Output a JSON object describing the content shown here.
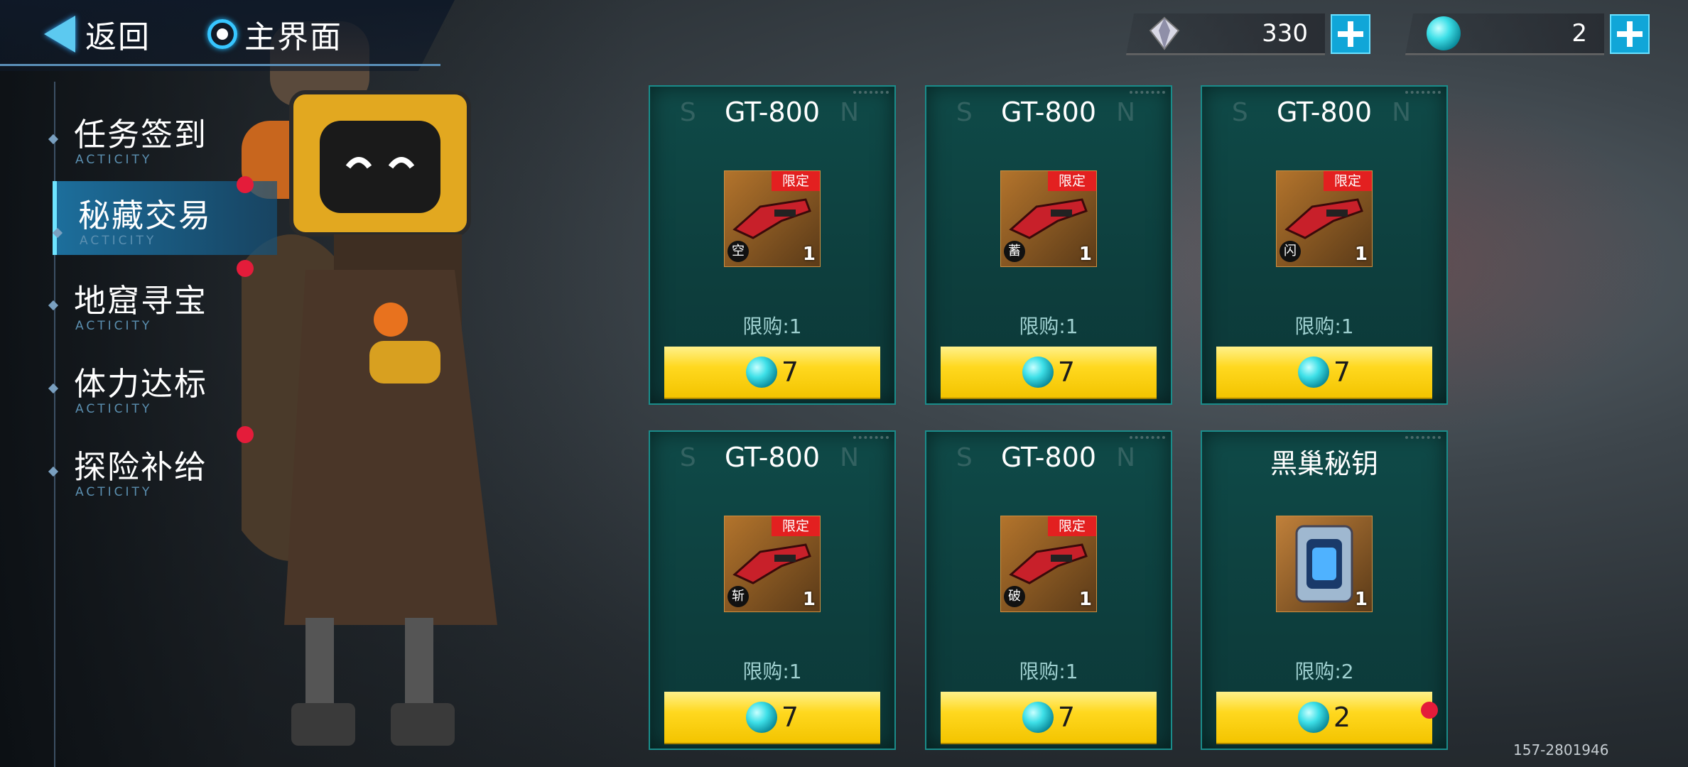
{
  "nav": {
    "back_label": "返回",
    "home_label": "主界面"
  },
  "currency": [
    {
      "icon": "crystal-icon",
      "value": "330"
    },
    {
      "icon": "orb-icon",
      "value": "2"
    }
  ],
  "sidebar": {
    "items": [
      {
        "label": "任务签到",
        "sub": "ACTICITY",
        "active": false,
        "dot": false
      },
      {
        "label": "秘藏交易",
        "sub": "ACTICITY",
        "active": true,
        "dot": true
      },
      {
        "label": "地窟寻宝",
        "sub": "ACTICITY",
        "active": false,
        "dot": true
      },
      {
        "label": "体力达标",
        "sub": "ACTICITY",
        "active": false,
        "dot": false
      },
      {
        "label": "探险补给",
        "sub": "ACTICITY",
        "active": false,
        "dot": true
      }
    ]
  },
  "cards": [
    {
      "title": "GT-800",
      "title_bg_left": "S",
      "title_bg_right": "N",
      "badge": "限定",
      "tag": "空",
      "qty": "1",
      "limit": "限购:1",
      "price": "7"
    },
    {
      "title": "GT-800",
      "title_bg_left": "S",
      "title_bg_right": "N",
      "badge": "限定",
      "tag": "蓄",
      "qty": "1",
      "limit": "限购:1",
      "price": "7"
    },
    {
      "title": "GT-800",
      "title_bg_left": "S",
      "title_bg_right": "N",
      "badge": "限定",
      "tag": "闪",
      "qty": "1",
      "limit": "限购:1",
      "price": "7"
    },
    {
      "title": "GT-800",
      "title_bg_left": "S",
      "title_bg_right": "N",
      "badge": "限定",
      "tag": "斩",
      "qty": "1",
      "limit": "限购:1",
      "price": "7"
    },
    {
      "title": "GT-800",
      "title_bg_left": "S",
      "title_bg_right": "N",
      "badge": "限定",
      "tag": "破",
      "qty": "1",
      "limit": "限购:1",
      "price": "7"
    },
    {
      "title": "黑巢秘钥",
      "title_bg_left": "",
      "title_bg_right": "",
      "badge": "",
      "tag": "",
      "qty": "1",
      "limit": "限购:2",
      "price": "2"
    }
  ],
  "footer_id": "157-2801946",
  "colors": {
    "accent": "#37c6ff",
    "alert": "#e41c3a",
    "button": "#ffd81f",
    "card": "#0f4a48"
  }
}
